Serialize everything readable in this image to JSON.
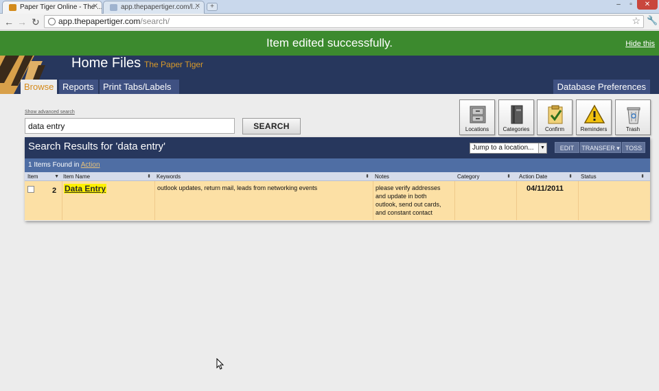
{
  "browser": {
    "tabs": [
      {
        "title": "Paper Tiger Online - The ...",
        "active": true
      },
      {
        "title": "app.thepapertiger.com/l...",
        "active": false
      }
    ],
    "new_tab": "+",
    "url_host": "app.thepapertiger.com",
    "url_path": "/search/",
    "window_controls": [
      "–",
      "▫",
      "✕"
    ]
  },
  "banner": {
    "message": "Item edited successfully.",
    "hide_link": "Hide this",
    "color": "#3c8a2e"
  },
  "header": {
    "title": "Home Files",
    "subtitle": "The Paper Tiger",
    "nav_tabs": [
      {
        "label": "Browse",
        "active": true
      },
      {
        "label": "Reports",
        "active": false
      },
      {
        "label": "Print Tabs/Labels",
        "active": false
      }
    ],
    "db_preferences": "Database Preferences",
    "brand_color": "#27375d",
    "accent_color": "#d58a1a"
  },
  "search": {
    "advanced_link": "Show advanced search",
    "query": "data entry",
    "button": "SEARCH"
  },
  "toolbox": [
    {
      "label": "Locations",
      "icon": "cabinet-icon"
    },
    {
      "label": "Categories",
      "icon": "binder-icon"
    },
    {
      "label": "Confirm",
      "icon": "clipboard-check-icon"
    },
    {
      "label": "Reminders",
      "icon": "warning-icon"
    },
    {
      "label": "Trash",
      "icon": "trash-can-icon"
    }
  ],
  "results": {
    "title": "Search Results for 'data entry'",
    "jump_select": "Jump to a location...",
    "actions": [
      "EDIT",
      "TRANSFER ▾",
      "TOSS"
    ],
    "found_text": "1 Items Found in",
    "found_link": "Action",
    "columns": [
      "Item",
      "Item Name",
      "Keywords",
      "Notes",
      "Category",
      "Action Date",
      "Status"
    ],
    "rows": [
      {
        "item": "2",
        "item_name": "Data Entry",
        "keywords": "outlook updates, return mail, leads from networking events",
        "notes": [
          "please verify addresses",
          "and update in both",
          "outlook, send out cards,",
          "and constant contact"
        ],
        "category": "",
        "action_date": "04/11/2011",
        "status": ""
      }
    ]
  }
}
